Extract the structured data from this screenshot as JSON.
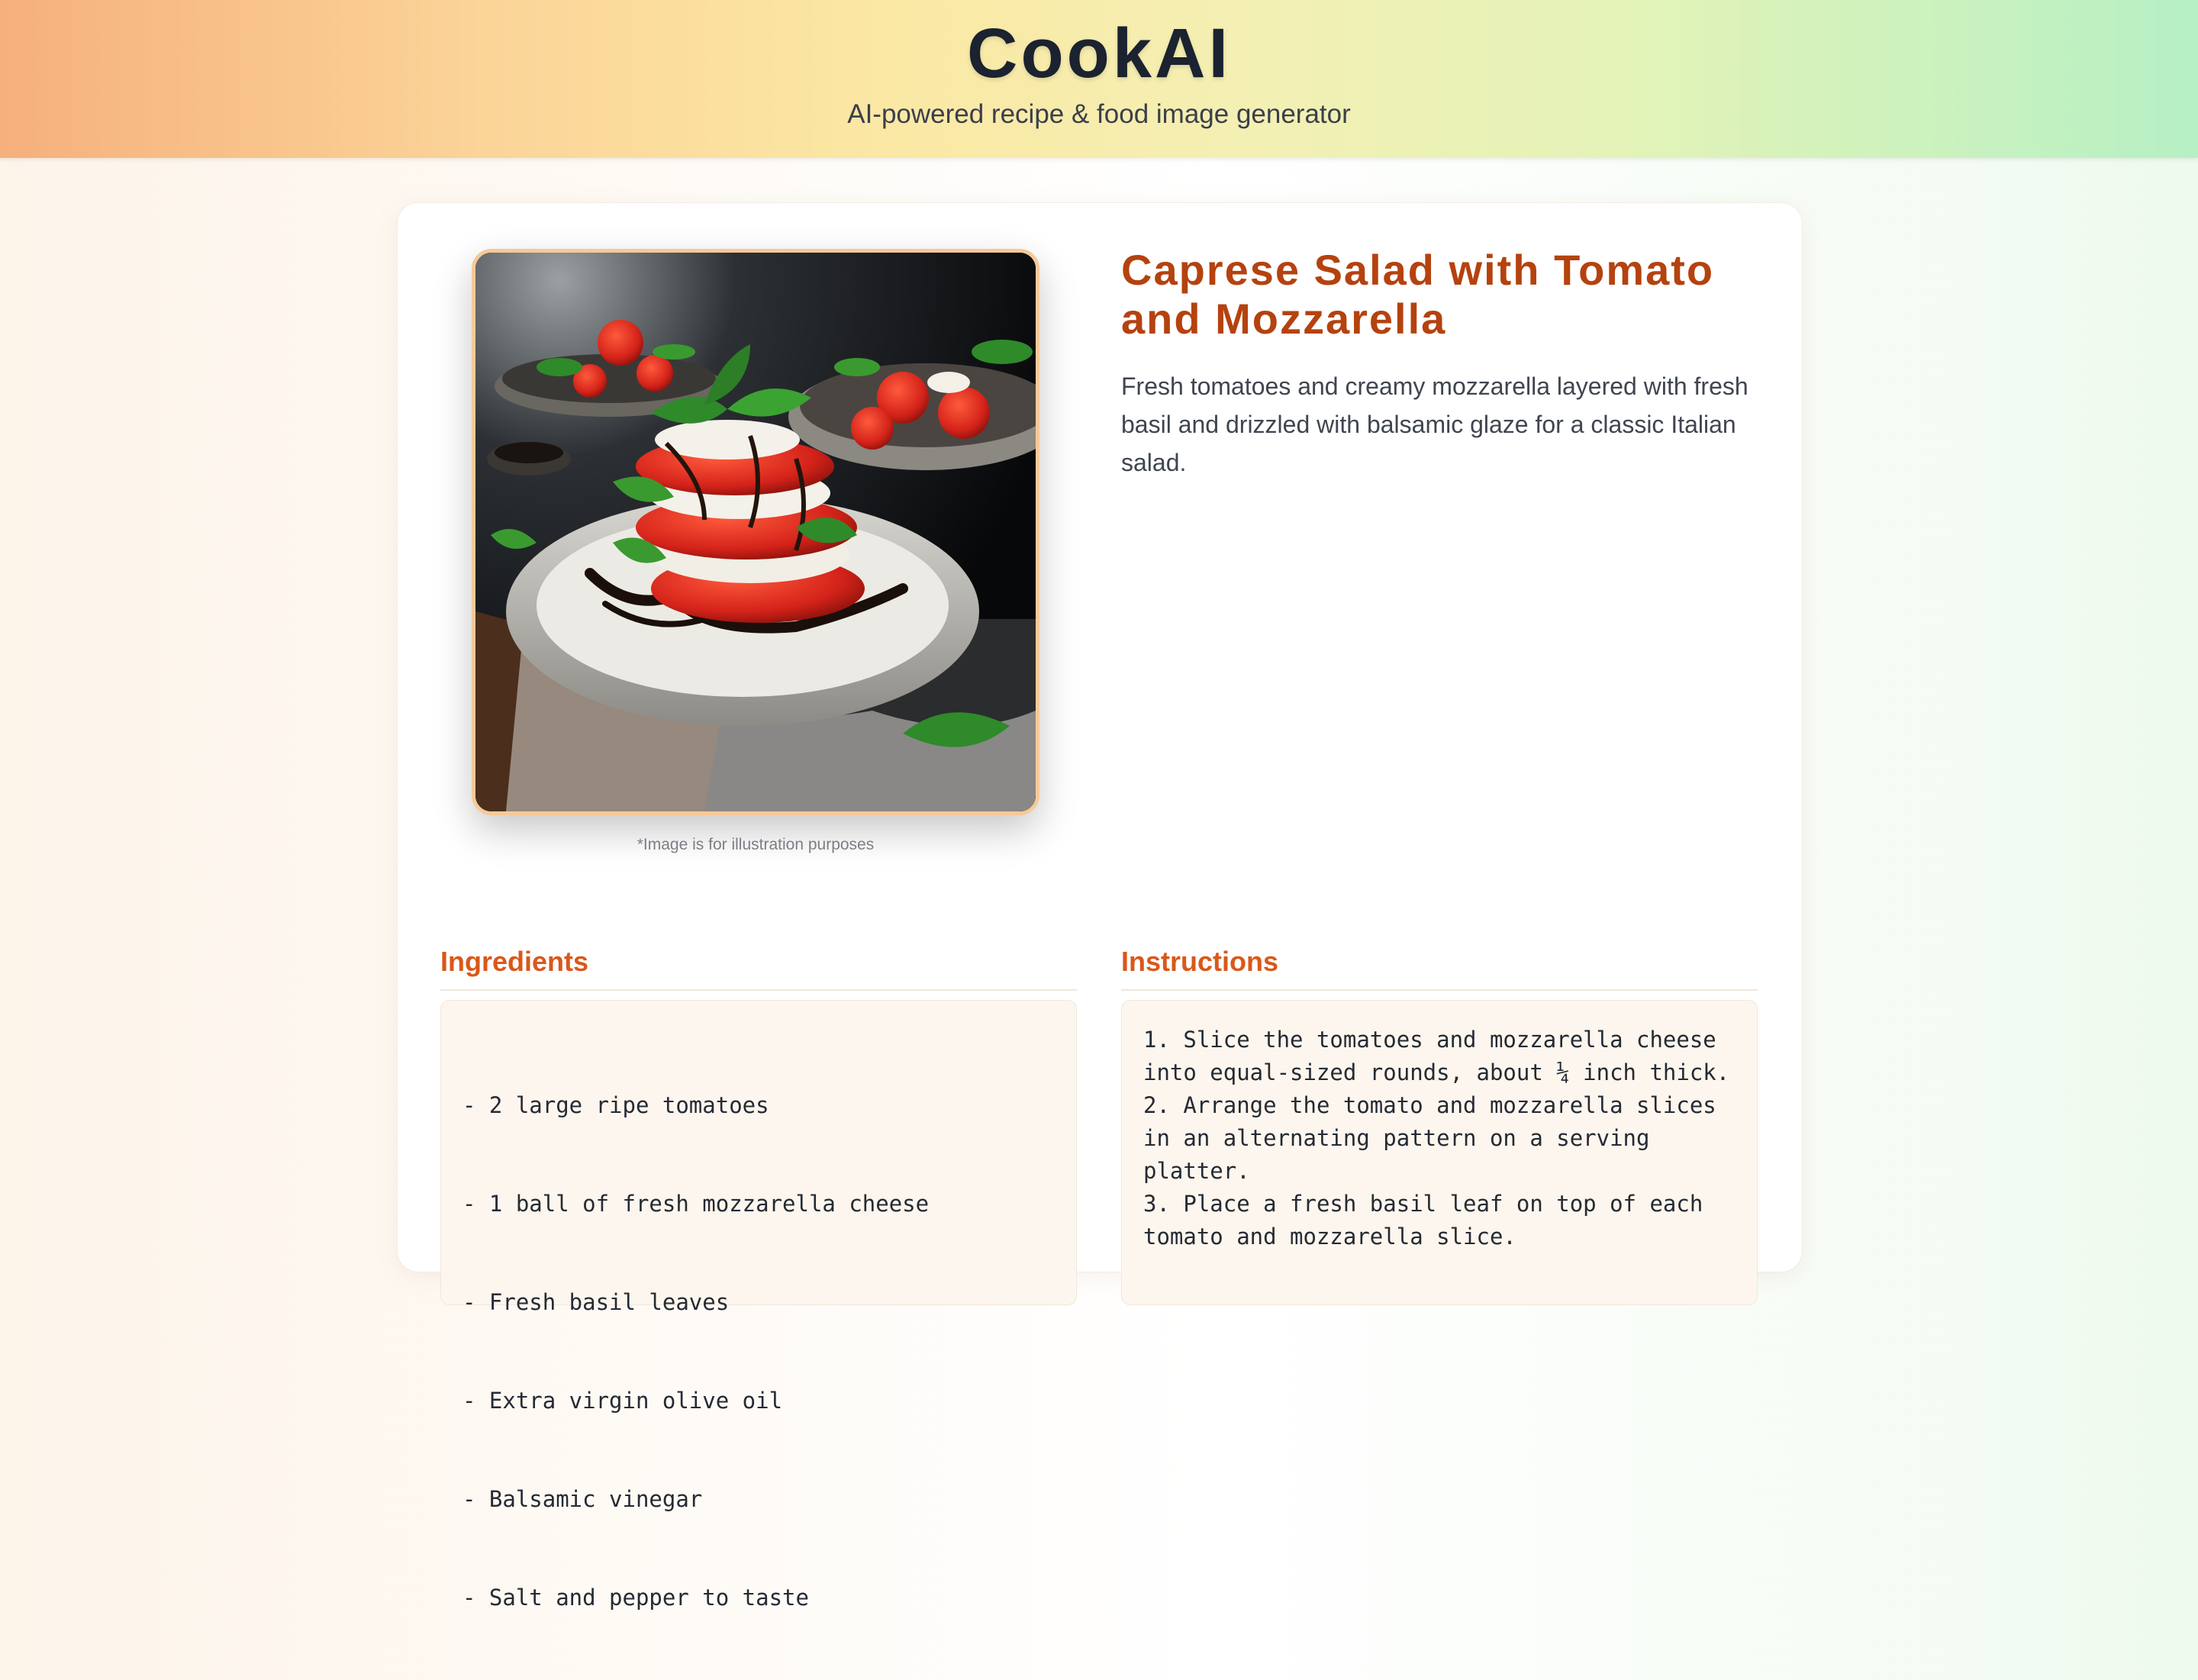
{
  "header": {
    "title": "CookAI",
    "subtitle": "AI-powered recipe & food image generator"
  },
  "recipe": {
    "image_alt": "Caprese salad stacked with tomato, mozzarella and basil, drizzled with balsamic glaze",
    "image_caption": "*Image is for illustration purposes",
    "title": "Caprese Salad with Tomato and Mozzarella",
    "description": "Fresh tomatoes and creamy mozzarella layered with fresh basil and drizzled with balsamic glaze for a classic Italian salad."
  },
  "ingredients": {
    "heading": "Ingredients",
    "items": [
      "- 2 large ripe tomatoes",
      "- 1 ball of fresh mozzarella cheese",
      "- Fresh basil leaves",
      "- Extra virgin olive oil",
      "- Balsamic vinegar",
      "- Salt and pepper to taste"
    ]
  },
  "instructions": {
    "heading": "Instructions",
    "text": "1. Slice the tomatoes and mozzarella cheese into equal-sized rounds, about ¼ inch thick.\n2. Arrange the tomato and mozzarella slices in an alternating pattern on a serving platter.\n3. Place a fresh basil leaf on top of each tomato and mozzarella slice."
  },
  "colors": {
    "accent": "#d9581a",
    "title": "#b5420f",
    "image_border": "#f6c999"
  }
}
